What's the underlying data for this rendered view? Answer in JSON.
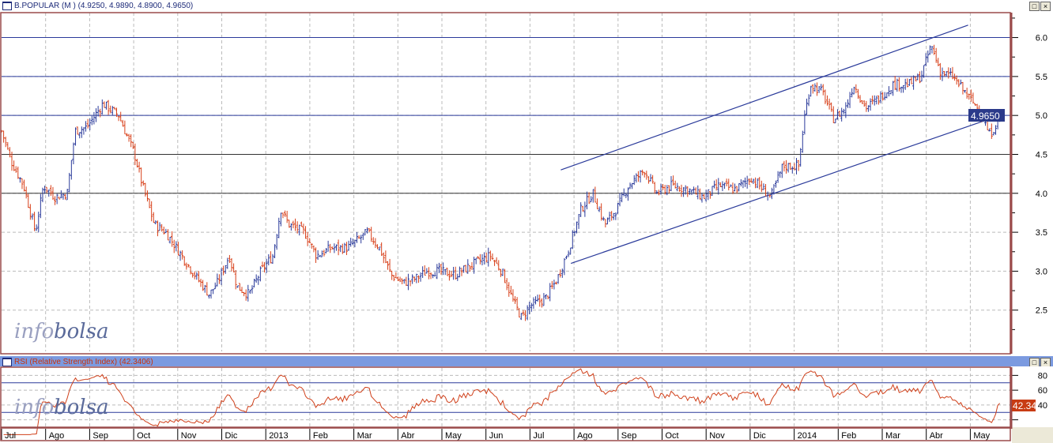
{
  "price_panel": {
    "title": "B.POPULAR (M ) (4.9250, 4.9890, 4.8900, 4.9650)",
    "last_label": "4.9650",
    "watermark_a": "info",
    "watermark_b": "bolsa"
  },
  "rsi_panel": {
    "title": "RSI (Relative Strength Index) (42.3406)",
    "last_label": "42.34",
    "watermark_a": "info",
    "watermark_b": "bolsa"
  },
  "window_buttons": {
    "maximize": "□",
    "close": "×"
  },
  "colors": {
    "up": "#2a3a9a",
    "down": "#d8401a",
    "hline": "#2a3a9a",
    "rsi": "#d0401a",
    "axis": "#9a4a4a"
  },
  "chart_data": [
    {
      "type": "ohlc",
      "title": "B.POPULAR (M )",
      "ylim": [
        1.97,
        6.32
      ],
      "y_ticks": [
        "6.0",
        "5.5",
        "5.0",
        "4.5",
        "4.0",
        "3.5",
        "3.0",
        "2.5"
      ],
      "horizontal_lines": [
        6.0,
        5.5,
        5.0,
        4.5,
        4.0
      ],
      "trend_lines": [
        [
          [
            12.7,
            4.3
          ],
          [
            21.95,
            6.16
          ]
        ],
        [
          [
            12.93,
            3.1
          ],
          [
            22.67,
            5.0
          ]
        ]
      ],
      "x_unit": "months since Jul 2012",
      "close_path": [
        [
          0,
          4.8
        ],
        [
          0.23,
          4.4
        ],
        [
          0.5,
          4.1
        ],
        [
          0.77,
          3.5
        ],
        [
          0.95,
          4.1
        ],
        [
          1.22,
          3.95
        ],
        [
          1.49,
          4.0
        ],
        [
          1.67,
          4.8
        ],
        [
          1.94,
          4.85
        ],
        [
          2.3,
          5.15
        ],
        [
          2.66,
          5.0
        ],
        [
          3.02,
          4.5
        ],
        [
          3.2,
          4.1
        ],
        [
          3.47,
          3.6
        ],
        [
          3.73,
          3.5
        ],
        [
          4.09,
          3.2
        ],
        [
          4.45,
          2.9
        ],
        [
          4.72,
          2.7
        ],
        [
          4.9,
          2.85
        ],
        [
          5.17,
          3.2
        ],
        [
          5.35,
          2.8
        ],
        [
          5.62,
          2.7
        ],
        [
          5.89,
          3.0
        ],
        [
          6.16,
          3.2
        ],
        [
          6.34,
          3.8
        ],
        [
          6.52,
          3.6
        ],
        [
          6.88,
          3.5
        ],
        [
          7.15,
          3.2
        ],
        [
          7.5,
          3.3
        ],
        [
          7.86,
          3.3
        ],
        [
          8.31,
          3.5
        ],
        [
          8.58,
          3.3
        ],
        [
          8.85,
          2.95
        ],
        [
          9.12,
          2.85
        ],
        [
          9.39,
          2.9
        ],
        [
          9.66,
          3.0
        ],
        [
          9.93,
          3.0
        ],
        [
          10.29,
          2.95
        ],
        [
          10.74,
          3.1
        ],
        [
          11.1,
          3.2
        ],
        [
          11.36,
          3.0
        ],
        [
          11.63,
          2.6
        ],
        [
          11.81,
          2.4
        ],
        [
          11.99,
          2.55
        ],
        [
          12.35,
          2.65
        ],
        [
          12.62,
          2.9
        ],
        [
          12.89,
          3.3
        ],
        [
          13.16,
          3.8
        ],
        [
          13.43,
          4.0
        ],
        [
          13.7,
          3.6
        ],
        [
          13.97,
          3.8
        ],
        [
          14.24,
          4.1
        ],
        [
          14.6,
          4.3
        ],
        [
          14.87,
          4.0
        ],
        [
          15.22,
          4.1
        ],
        [
          15.58,
          4.05
        ],
        [
          15.94,
          3.95
        ],
        [
          16.3,
          4.1
        ],
        [
          16.66,
          4.05
        ],
        [
          17.02,
          4.2
        ],
        [
          17.47,
          3.95
        ],
        [
          17.74,
          4.35
        ],
        [
          18.1,
          4.35
        ],
        [
          18.24,
          5.0
        ],
        [
          18.37,
          5.4
        ],
        [
          18.64,
          5.3
        ],
        [
          18.9,
          4.95
        ],
        [
          19.17,
          5.1
        ],
        [
          19.35,
          5.4
        ],
        [
          19.62,
          5.1
        ],
        [
          19.89,
          5.2
        ],
        [
          20.25,
          5.4
        ],
        [
          20.61,
          5.4
        ],
        [
          20.88,
          5.5
        ],
        [
          21.11,
          5.9
        ],
        [
          21.33,
          5.55
        ],
        [
          21.6,
          5.5
        ],
        [
          21.87,
          5.3
        ],
        [
          22.23,
          5.05
        ],
        [
          22.44,
          4.75
        ],
        [
          22.67,
          4.965
        ]
      ]
    },
    {
      "type": "line",
      "title": "RSI (Relative Strength Index)",
      "ylim": [
        10,
        90
      ],
      "y_ticks": [
        "80",
        "60",
        "40"
      ],
      "horizontal_lines": [
        70,
        30
      ],
      "last_value": 42.3406
    }
  ],
  "x_axis": {
    "labels": [
      "Jul",
      "Ago",
      "Sep",
      "Oct",
      "Nov",
      "Dic",
      "2013",
      "Feb",
      "Mar",
      "Abr",
      "May",
      "Jun",
      "Jul",
      "Ago",
      "Sep",
      "Oct",
      "Nov",
      "Dic",
      "2014",
      "Feb",
      "Mar",
      "Abr",
      "May"
    ]
  }
}
